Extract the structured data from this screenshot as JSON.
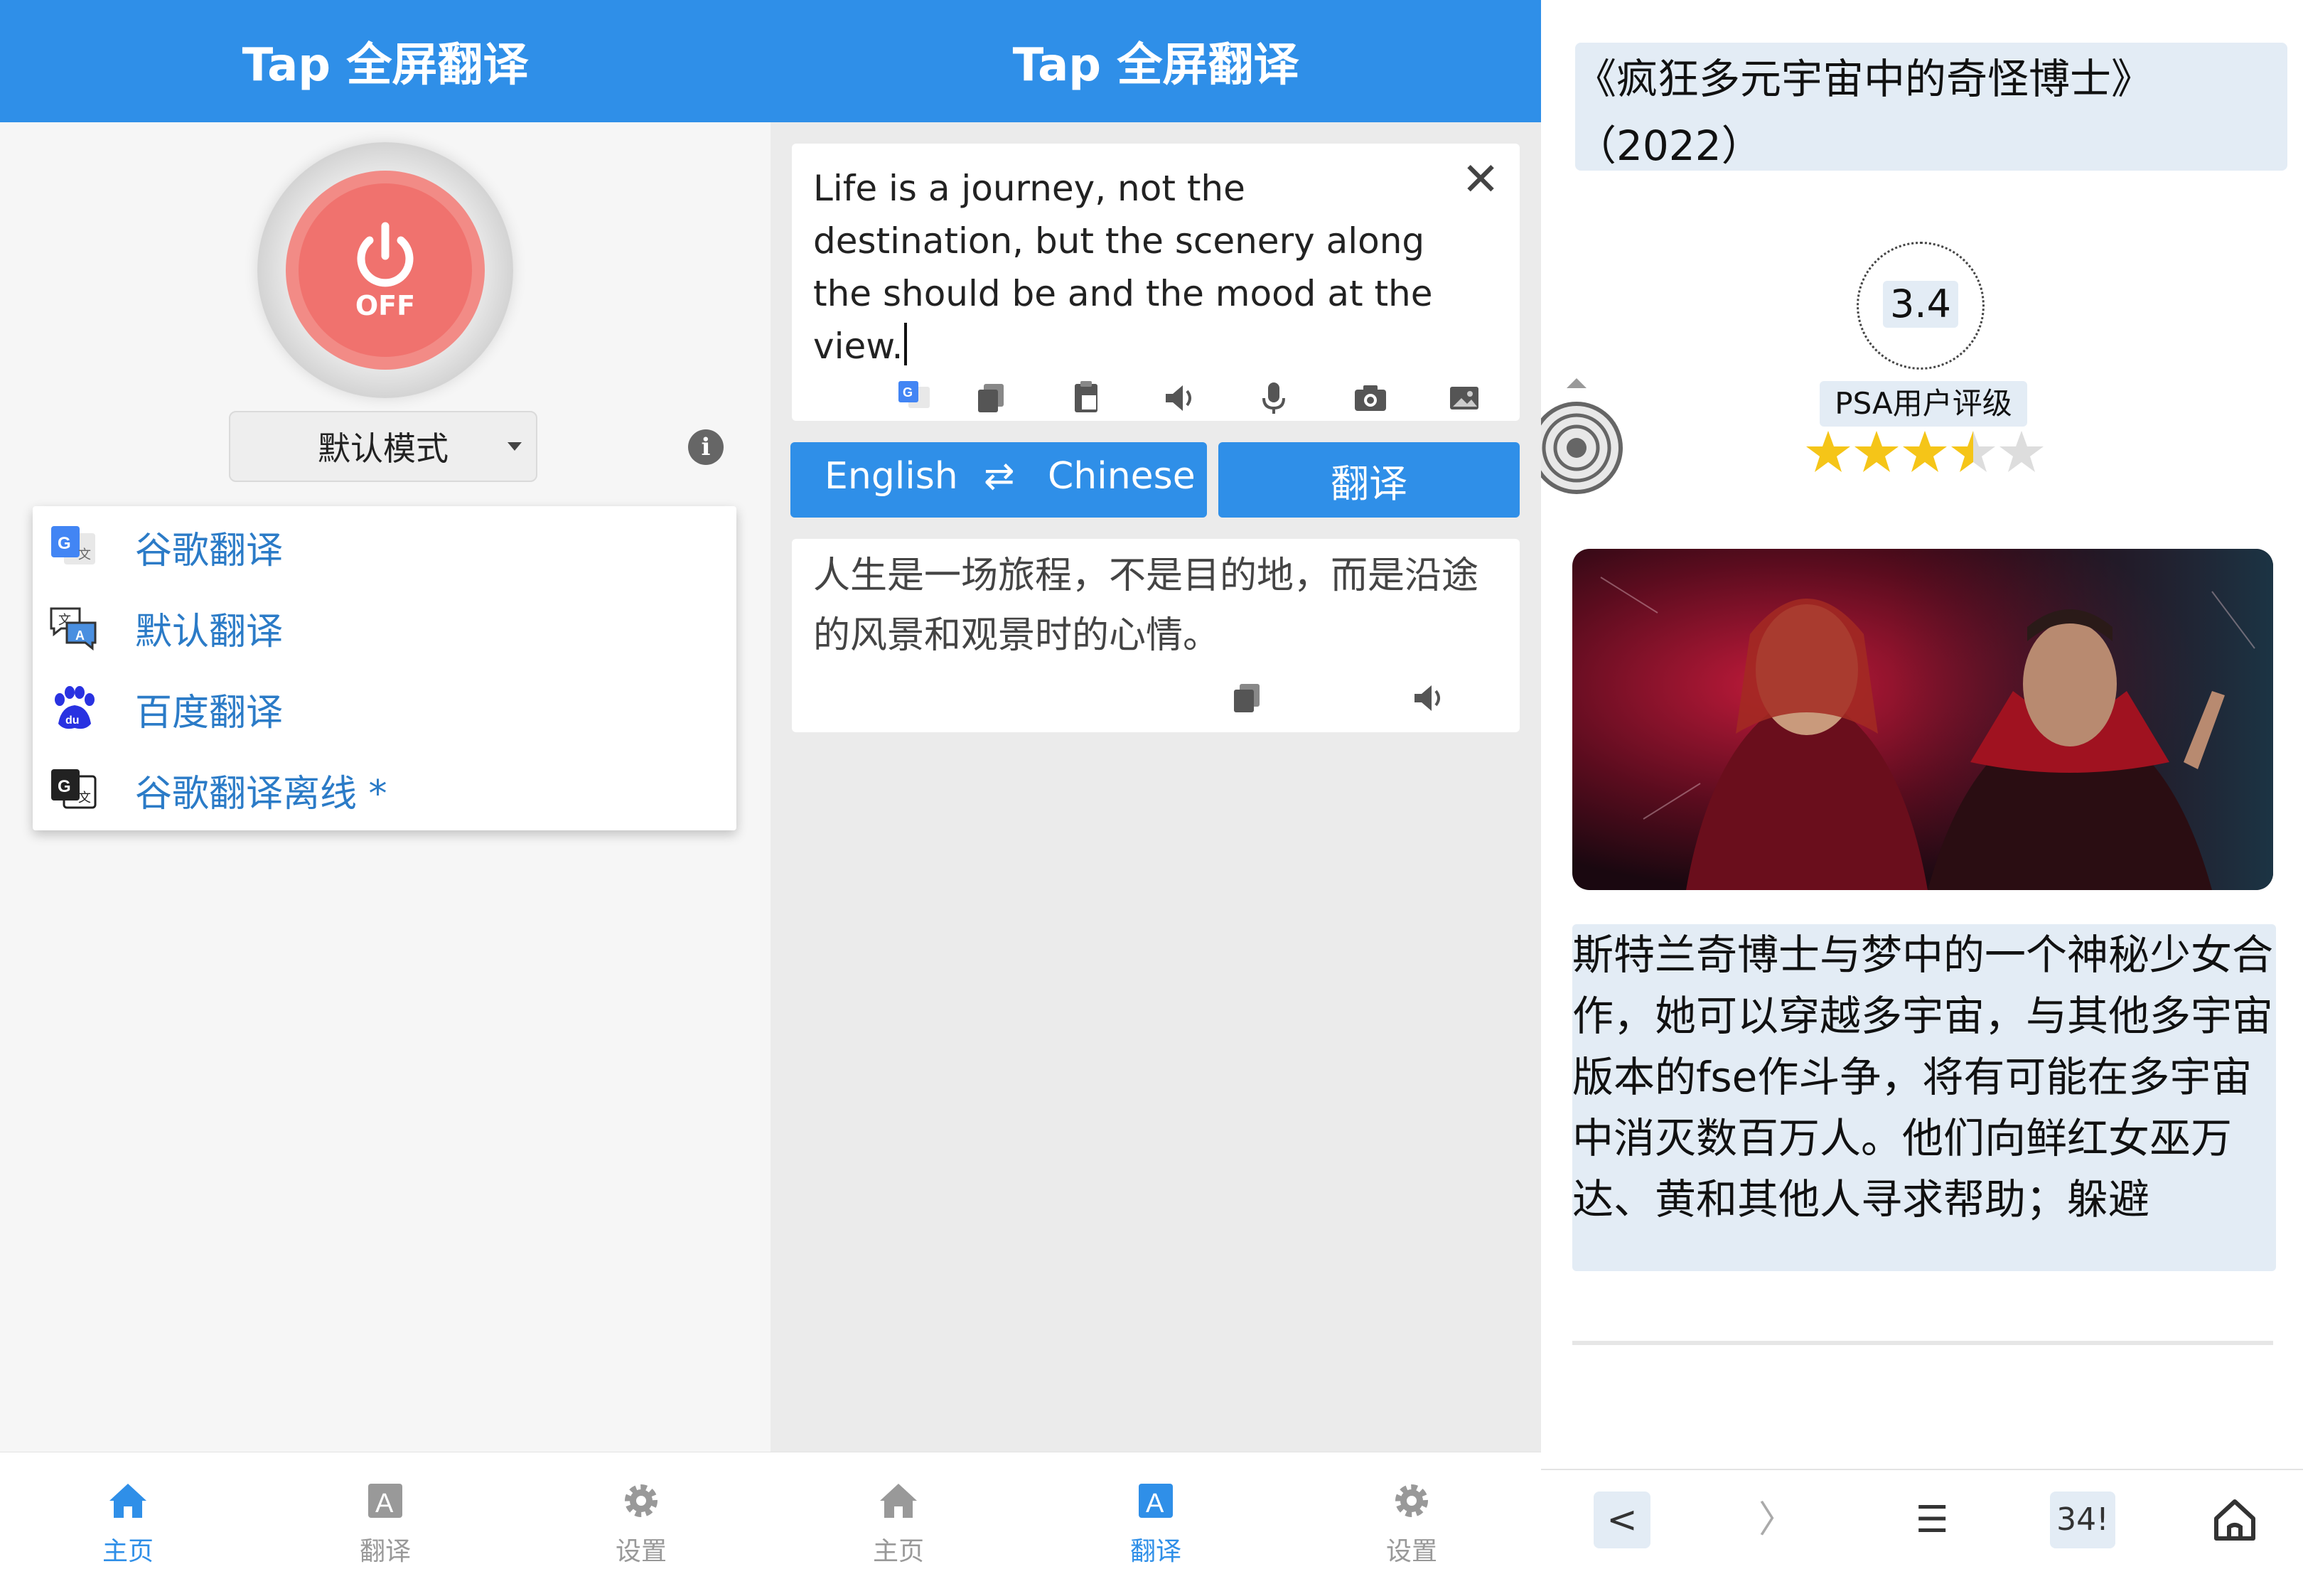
{
  "app_title": "Tap 全屏翻译",
  "home": {
    "power_state": "OFF",
    "mode_select": "默认模式",
    "info_icon": "i",
    "engines": [
      {
        "label": "谷歌翻译",
        "icon": "google-translate-icon"
      },
      {
        "label": "默认翻译",
        "icon": "chat-translate-icon"
      },
      {
        "label": "百度翻译",
        "icon": "baidu-paw-icon"
      },
      {
        "label": "谷歌翻译离线 *",
        "icon": "google-translate-offline-icon"
      }
    ]
  },
  "nav": {
    "home": "主页",
    "translate": "翻译",
    "settings": "设置"
  },
  "translate": {
    "source_text": "Life is a journey, not the destination, but the scenery along the should be and the mood at the view.",
    "close": "✕",
    "source_lang": "English",
    "swap": "⇄",
    "target_lang": "Chinese",
    "translate_button": "翻译",
    "output_text": "人生是一场旅程，不是目的地，而是沿途的风景和观景时的心情。"
  },
  "reader": {
    "title": "《疯狂多元宇宙中的奇怪博士》（2022）",
    "rating_value": "3.4",
    "rating_label": "PSA用户评级",
    "stars": 3.5,
    "description": "斯特兰奇博士与梦中的一个神秘少女合作，她可以穿越多宇宙，与其他多宇宙版本的fse作斗争，将有可能在多宇宙中消灭数百万人。他们向鲜红女巫万达、黄和其他人寻求帮助；躲避",
    "browser": {
      "back": "<",
      "forward": "〉",
      "menu": "☰",
      "tabs": "34!"
    }
  },
  "colors": {
    "primary": "#2f8fe8",
    "power_red": "#f0726e",
    "link": "#2b7bc7",
    "star": "#f5c518"
  }
}
